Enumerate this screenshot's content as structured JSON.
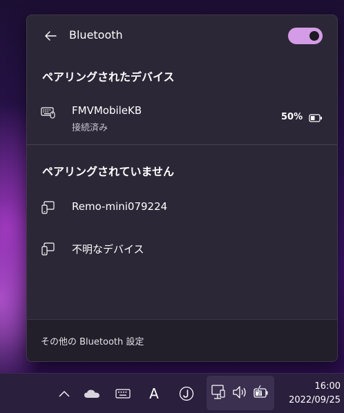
{
  "panel": {
    "title": "Bluetooth",
    "toggle_on": true,
    "paired_section": {
      "title": "ペアリングされたデバイス",
      "devices": [
        {
          "name": "FMVMobileKB",
          "status": "接続済み",
          "battery": "50%",
          "icon": "keyboard-icon"
        }
      ]
    },
    "unpaired_section": {
      "title": "ペアリングされていません",
      "devices": [
        {
          "name": "Remo-mini079224",
          "icon": "device-icon"
        },
        {
          "name": "不明なデバイス",
          "icon": "device-icon"
        }
      ]
    },
    "footer_link": "その他の Bluetooth 設定"
  },
  "taskbar": {
    "ime_mode": "A",
    "time": "16:00",
    "date": "2022/09/25"
  },
  "colors": {
    "accent": "#d49ce6",
    "panel_bg": "#2c2736",
    "footer_bg": "#221e2a"
  }
}
